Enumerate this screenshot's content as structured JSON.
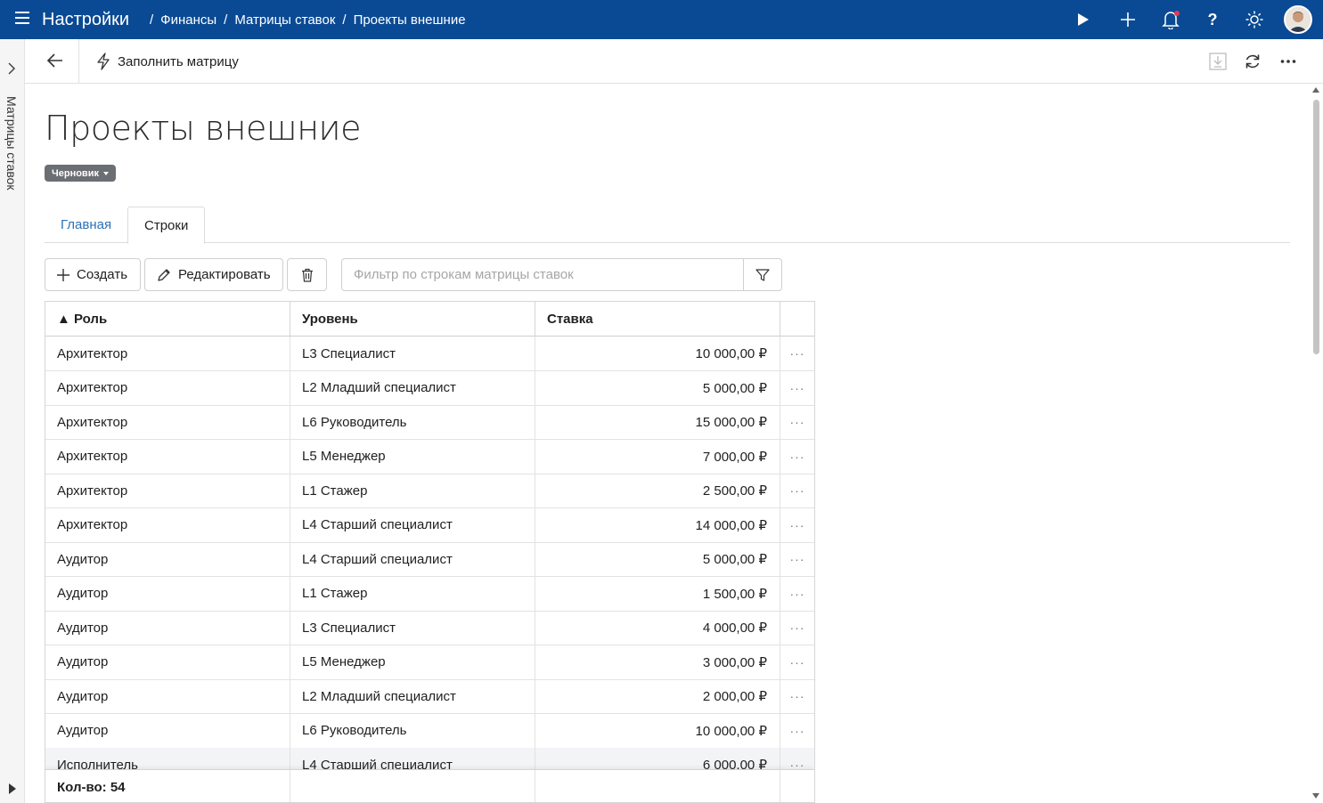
{
  "topbar": {
    "app_title": "Настройки",
    "breadcrumbs": [
      "Финансы",
      "Матрицы ставок",
      "Проекты внешние"
    ],
    "icons": [
      "menu-icon",
      "play-icon",
      "plus-icon",
      "bell-icon",
      "help-icon",
      "sun-icon",
      "avatar"
    ],
    "help_glyph": "?"
  },
  "side_panel": {
    "label": "Матрицы ставок"
  },
  "command_bar": {
    "fill_matrix_label": "Заполнить матрицу"
  },
  "page": {
    "title": "Проекты внешние",
    "status": "Черновик"
  },
  "tabs": [
    {
      "label": "Главная",
      "active": false
    },
    {
      "label": "Строки",
      "active": true
    }
  ],
  "toolbar": {
    "create_label": "Создать",
    "edit_label": "Редактировать",
    "filter_placeholder": "Фильтр по строкам матрицы ставок"
  },
  "grid": {
    "columns": [
      "▲ Роль",
      "Уровень",
      "Ставка"
    ],
    "rows": [
      {
        "role": "Архитектор",
        "level": "L3 Специалист",
        "rate": "10 000,00 ₽"
      },
      {
        "role": "Архитектор",
        "level": "L2 Младший специалист",
        "rate": "5 000,00 ₽"
      },
      {
        "role": "Архитектор",
        "level": "L6 Руководитель",
        "rate": "15 000,00 ₽"
      },
      {
        "role": "Архитектор",
        "level": "L5 Менеджер",
        "rate": "7 000,00 ₽"
      },
      {
        "role": "Архитектор",
        "level": "L1 Стажер",
        "rate": "2 500,00 ₽"
      },
      {
        "role": "Архитектор",
        "level": "L4 Старший специалист",
        "rate": "14 000,00 ₽"
      },
      {
        "role": "Аудитор",
        "level": "L4 Старший специалист",
        "rate": "5 000,00 ₽"
      },
      {
        "role": "Аудитор",
        "level": "L1 Стажер",
        "rate": "1 500,00 ₽"
      },
      {
        "role": "Аудитор",
        "level": "L3 Специалист",
        "rate": "4 000,00 ₽"
      },
      {
        "role": "Аудитор",
        "level": "L5 Менеджер",
        "rate": "3 000,00 ₽"
      },
      {
        "role": "Аудитор",
        "level": "L2 Младший специалист",
        "rate": "2 000,00 ₽"
      },
      {
        "role": "Аудитор",
        "level": "L6 Руководитель",
        "rate": "10 000,00 ₽"
      },
      {
        "role": "Исполнитель",
        "level": "L4 Старший специалист",
        "rate": "6 000,00 ₽"
      }
    ],
    "row_action_glyph": "···",
    "footer_count": "Кол-во: 54"
  },
  "colors": {
    "topbar": "#0a4a94",
    "link": "#2b72b8",
    "status_badge": "#6b6e73",
    "notification_dot": "#e63757"
  }
}
